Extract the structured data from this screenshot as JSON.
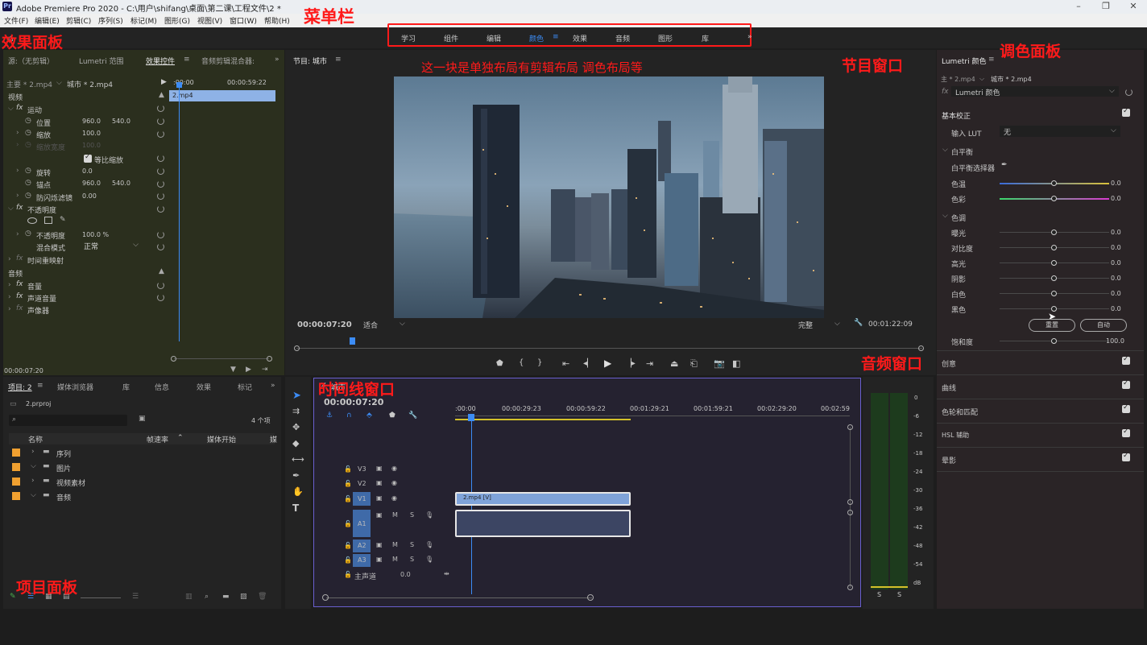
{
  "window": {
    "title": "Adobe Premiere Pro 2020 - C:\\用户\\shifang\\桌面\\第二课\\工程文件\\2 *",
    "app_icon": "Pr"
  },
  "menu": [
    "文件(F)",
    "编辑(E)",
    "剪辑(C)",
    "序列(S)",
    "标记(M)",
    "图形(G)",
    "视图(V)",
    "窗口(W)",
    "帮助(H)"
  ],
  "workspaces": {
    "items": [
      "学习",
      "组件",
      "编辑",
      "颜色",
      "效果",
      "音频",
      "图形",
      "库"
    ],
    "active": "颜色",
    "more": "»"
  },
  "annotations": {
    "menubar": "菜单栏",
    "effects_panel": "效果面板",
    "program_window": "节目窗口",
    "lumetri_panel": "调色面板",
    "layout_note": "这一块是单独布局有剪辑布局 调色布局等",
    "audio_window": "音频窗口",
    "timeline_window": "时间线窗口",
    "project_panel": "项目面板"
  },
  "effects": {
    "tabs": [
      "源:（无剪辑）",
      "Lumetri 范围",
      "效果控件",
      "音频剪辑混合器:"
    ],
    "active_tab": "效果控件",
    "master": "主要 * 2.mp4",
    "clip_link": "城市 * 2.mp4",
    "ruler_start": ":00:00",
    "ruler_end": "00:00:59:22",
    "clip_bar": "2.mp4",
    "section_video": "视频",
    "motion": "运动",
    "position": {
      "label": "位置",
      "x": "960.0",
      "y": "540.0"
    },
    "scale": {
      "label": "缩放",
      "value": "100.0"
    },
    "scale_width": {
      "label": "缩放宽度",
      "value": "100.0"
    },
    "uniform_scale": "等比缩放",
    "rotation": {
      "label": "旋转",
      "value": "0.0"
    },
    "anchor": {
      "label": "锚点",
      "x": "960.0",
      "y": "540.0"
    },
    "antiflicker": {
      "label": "防闪烁滤镜",
      "value": "0.00"
    },
    "opacity_group": "不透明度",
    "opacity": {
      "label": "不透明度",
      "value": "100.0 %"
    },
    "blend": {
      "label": "混合模式",
      "value": "正常"
    },
    "time_remap": "时间重映射",
    "section_audio": "音频",
    "volume": "音量",
    "channel_volume": "声道音量",
    "panner": "声像器",
    "timecode": "00:00:07:20"
  },
  "program": {
    "title": "节目: 城市",
    "timecode": "00:00:07:20",
    "fit": "适合",
    "quality": "完整",
    "duration": "00:01:22:09"
  },
  "lumetri": {
    "title": "Lumetri 颜色",
    "master": "主 * 2.mp4",
    "clip_link": "城市 * 2.mp4",
    "fx_name": "Lumetri 颜色",
    "basic": "基本校正",
    "input_lut": {
      "label": "输入 LUT",
      "value": "无"
    },
    "white_balance": "白平衡",
    "wb_selector": "白平衡选择器",
    "temp": {
      "label": "色温",
      "value": "0.0"
    },
    "tint": {
      "label": "色彩",
      "value": "0.0"
    },
    "tone": "色调",
    "sliders": [
      {
        "label": "曝光",
        "value": "0.0"
      },
      {
        "label": "对比度",
        "value": "0.0"
      },
      {
        "label": "高光",
        "value": "0.0"
      },
      {
        "label": "阴影",
        "value": "0.0"
      },
      {
        "label": "白色",
        "value": "0.0"
      },
      {
        "label": "黑色",
        "value": "0.0"
      }
    ],
    "reset_btn": "重置",
    "auto_btn": "自动",
    "saturation": {
      "label": "饱和度",
      "value": "100.0"
    },
    "sections": [
      "创意",
      "曲线",
      "色轮和匹配",
      "HSL 辅助",
      "晕影"
    ]
  },
  "project": {
    "tabs": [
      "项目: 2",
      "媒体浏览器",
      "库",
      "信息",
      "效果",
      "标记"
    ],
    "active_tab": "项目: 2",
    "file": "2.prproj",
    "count": "4 个项",
    "columns": [
      "名称",
      "帧速率",
      "媒体开始",
      "媒"
    ],
    "items": [
      {
        "name": "序列",
        "expanded": false
      },
      {
        "name": "图片",
        "expanded": true
      },
      {
        "name": "视频素材",
        "expanded": false
      },
      {
        "name": "音频",
        "expanded": true
      }
    ]
  },
  "timeline": {
    "title": "城市",
    "timecode": "00:00:07:20",
    "ruler": [
      ":00:00",
      "00:00:29:23",
      "00:00:59:22",
      "00:01:29:21",
      "00:01:59:21",
      "00:02:29:20",
      "00:02:59"
    ],
    "video_tracks": [
      "V3",
      "V2",
      "V1"
    ],
    "audio_tracks": [
      "A1",
      "A2",
      "A3"
    ],
    "master": {
      "label": "主声道",
      "value": "0.0"
    },
    "clip_v": "2.mp4 [V]"
  },
  "audio_meter": {
    "scale": [
      "0",
      "-6",
      "-12",
      "-18",
      "-24",
      "-30",
      "-36",
      "-42",
      "-48",
      "-54",
      "dB"
    ],
    "solo": [
      "S",
      "S"
    ]
  },
  "colors": {
    "accent": "#3c8cf5",
    "annotation": "#ff1a1a",
    "panel": "#232323",
    "clip_video": "#7fa3d9"
  }
}
